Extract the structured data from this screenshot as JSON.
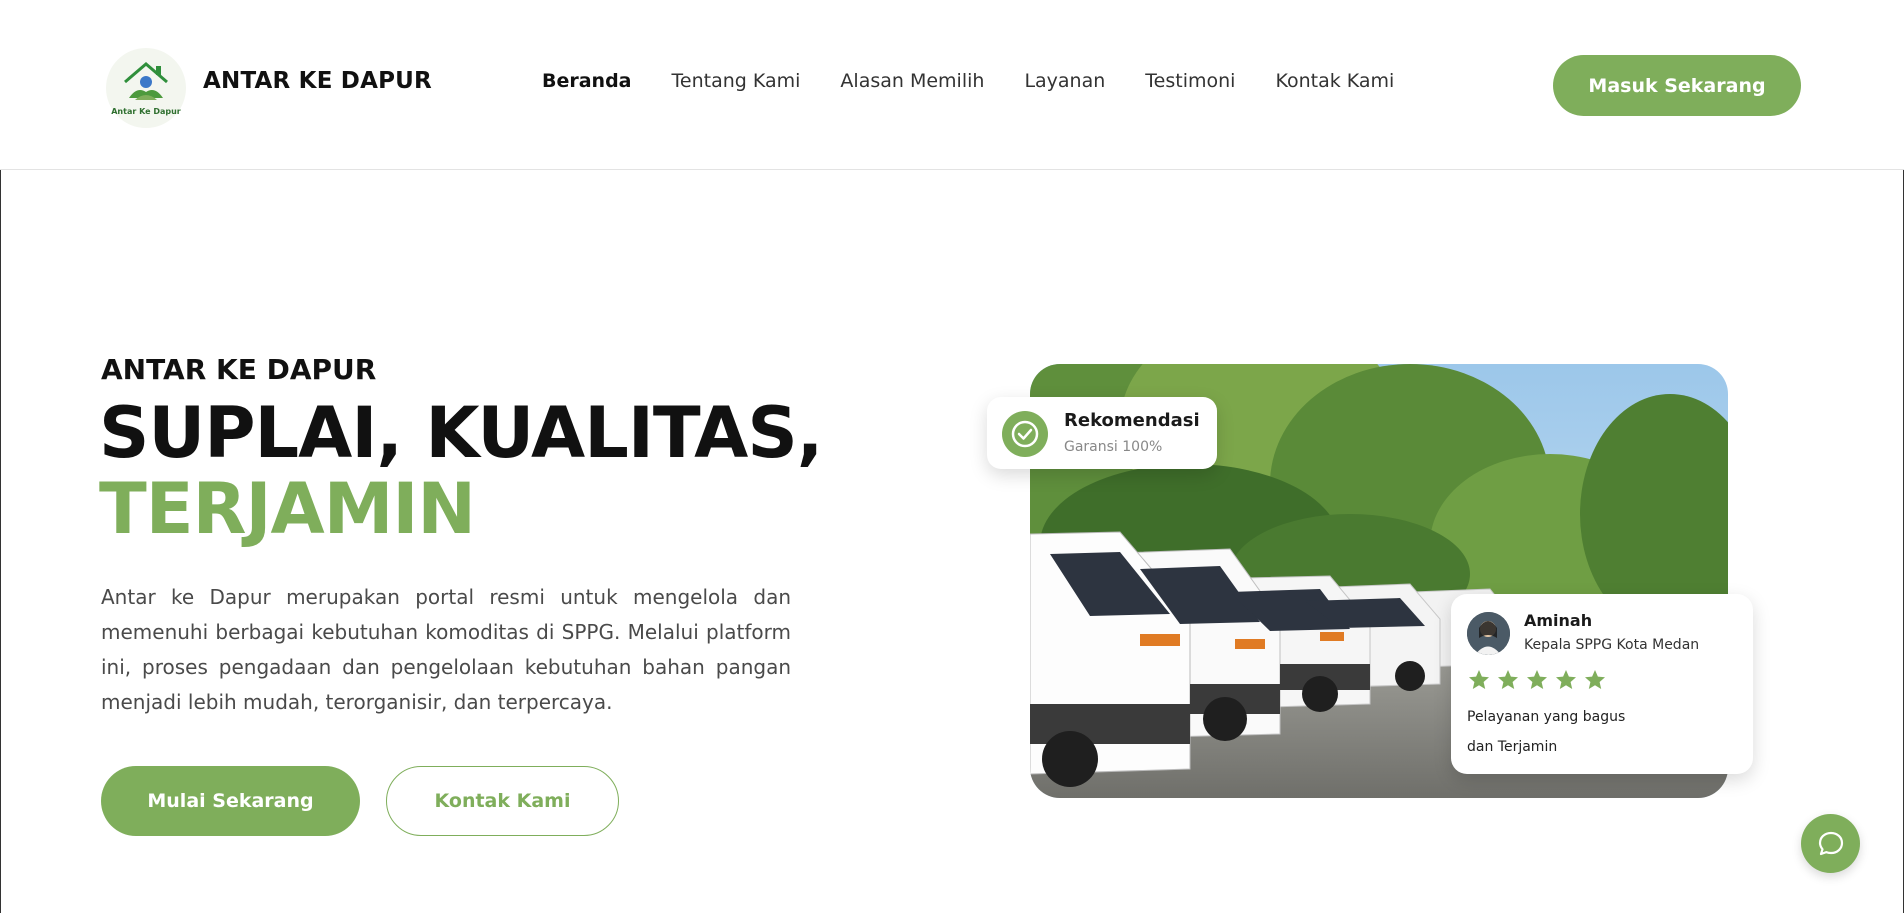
{
  "brand": {
    "name": "ANTAR KE DAPUR",
    "logo_caption": "Antar Ke Dapur",
    "accent_color": "#7fae5b"
  },
  "nav": {
    "items": [
      {
        "label": "Beranda",
        "active": true
      },
      {
        "label": "Tentang Kami",
        "active": false
      },
      {
        "label": "Alasan Memilih",
        "active": false
      },
      {
        "label": "Layanan",
        "active": false
      },
      {
        "label": "Testimoni",
        "active": false
      },
      {
        "label": "Kontak Kami",
        "active": false
      }
    ],
    "cta_label": "Masuk Sekarang"
  },
  "hero": {
    "eyebrow": "ANTAR KE DAPUR",
    "headline_line1": "SUPLAI, KUALITAS,",
    "headline_line2": "TERJAMIN",
    "description": "Antar ke Dapur merupakan portal resmi untuk mengelola dan memenuhi berbagai kebutuhan komoditas di SPPG. Melalui platform ini, proses pengadaan dan pengelolaan kebutuhan bahan pangan menjadi lebih mudah, terorganisir, dan terpercaya.",
    "primary_button": "Mulai Sekarang",
    "secondary_button": "Kontak Kami"
  },
  "badge": {
    "icon": "check-circle-icon",
    "title": "Rekomendasi",
    "subtitle": "Garansi 100%"
  },
  "testimonial": {
    "name": "Aminah",
    "role": "Kepala SPPG Kota Medan",
    "rating": 5,
    "quote_line1": "Pelayanan yang bagus",
    "quote_line2": "dan Terjamin"
  },
  "chat": {
    "icon": "chat-bubble-icon"
  }
}
